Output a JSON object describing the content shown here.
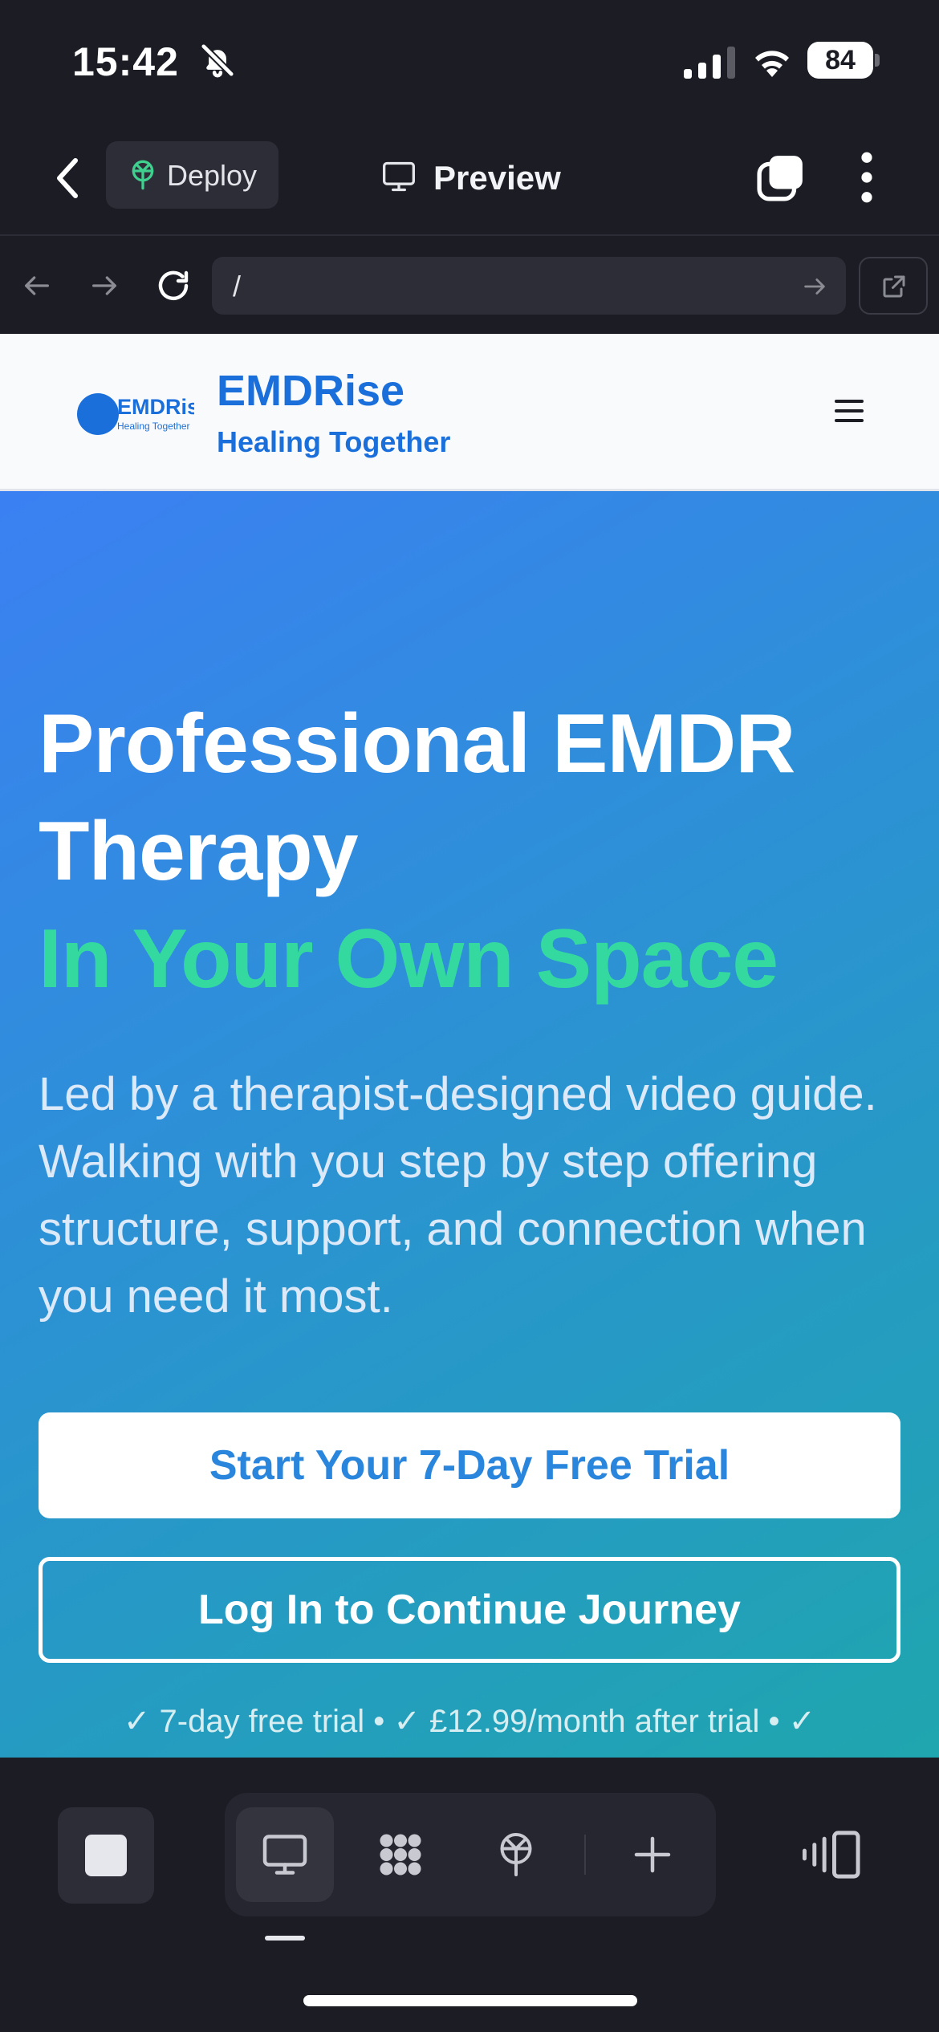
{
  "status_bar": {
    "time": "15:42",
    "battery": "84"
  },
  "toolbar": {
    "deploy_label": "Deploy",
    "preview_label": "Preview"
  },
  "url_bar": {
    "url": "/"
  },
  "site_header": {
    "logo_text": "EMDRise",
    "logo_tagline": "Healing Together",
    "brand_name": "EMDRise",
    "brand_tagline": "Healing Together"
  },
  "hero": {
    "headline_line1": "Professional EMDR",
    "headline_line2": "Therapy",
    "headline_highlight": "In Your Own Space",
    "description": "Led by a therapist-designed video guide. Walking with you step by step offering structure, support, and connection when you need it most.",
    "primary_cta": "Start Your 7-Day Free Trial",
    "secondary_cta": "Log In to Continue Journey",
    "trial_note": "✓ 7-day free trial • ✓ £12.99/month after trial • ✓"
  },
  "colors": {
    "brand_blue": "#1a6fdb",
    "highlight_green": "#34d9a0",
    "hero_gradient_start": "#3b80f3",
    "hero_gradient_end": "#1fa6ae",
    "chrome_dark": "#1b1c24"
  },
  "icons": {
    "status": [
      "bell-slash-icon",
      "signal-icon",
      "wifi-icon",
      "battery-icon"
    ],
    "toolbar": [
      "chevron-left-icon",
      "deploy-icon",
      "monitor-icon",
      "tabs-icon",
      "more-vertical-icon"
    ],
    "url_bar": [
      "arrow-left-icon",
      "arrow-right-icon",
      "reload-icon",
      "go-arrow-icon",
      "external-link-icon"
    ],
    "bottom_bar": [
      "stop-icon",
      "monitor-icon",
      "grid-dots-icon",
      "deploy-icon",
      "plus-icon",
      "device-switch-icon"
    ]
  }
}
